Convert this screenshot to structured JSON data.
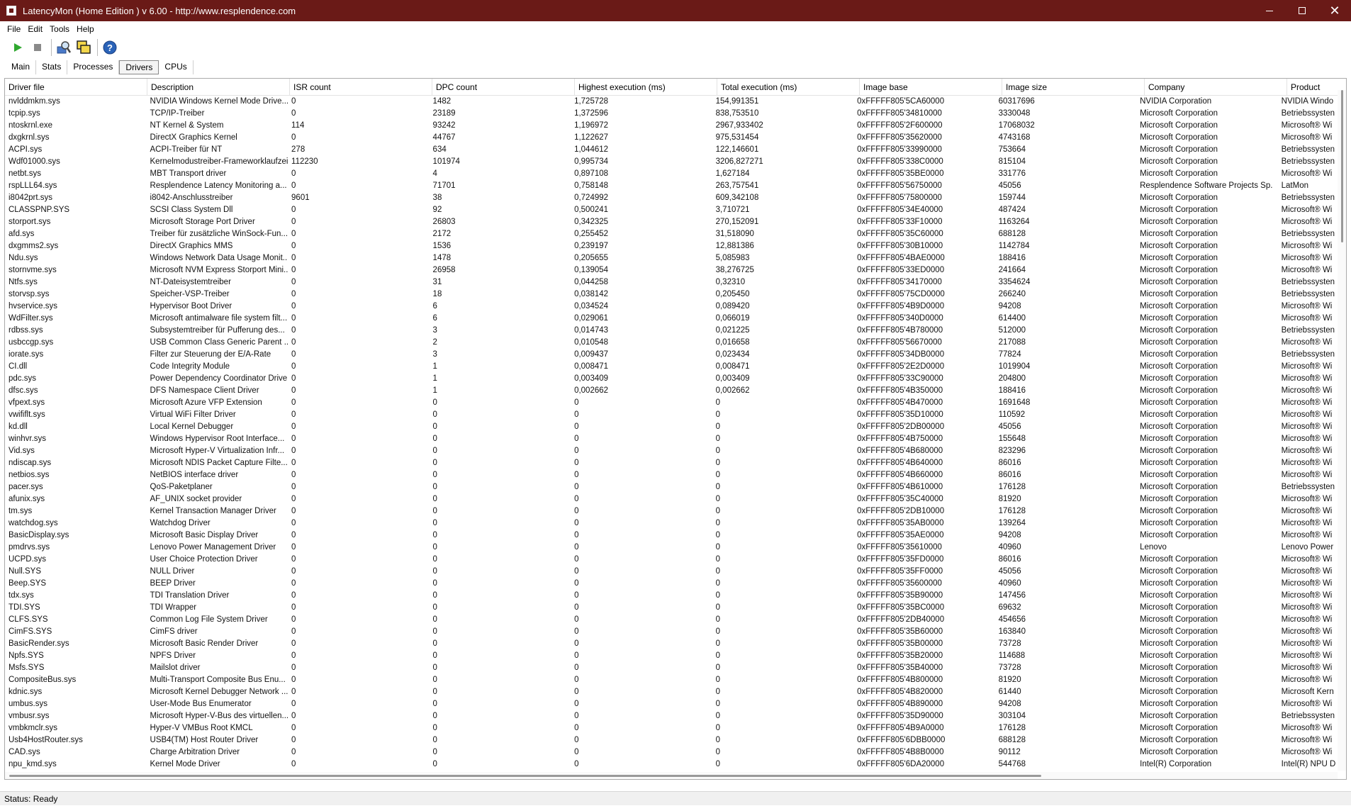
{
  "window": {
    "title": "LatencyMon  (Home Edition )  v 6.00 - http://www.resplendence.com",
    "minimize_label": "—",
    "close_label": "✕"
  },
  "menu": {
    "items": [
      "File",
      "Edit",
      "Tools",
      "Help"
    ]
  },
  "toolbar": {
    "buttons": [
      "play-icon",
      "stop-icon",
      "search-driver-icon",
      "windows-icon",
      "help-icon"
    ]
  },
  "tabs": {
    "items": [
      "Main",
      "Stats",
      "Processes",
      "Drivers",
      "CPUs"
    ],
    "active": "Drivers"
  },
  "table": {
    "columns": [
      "Driver file",
      "Description",
      "ISR count",
      "DPC count",
      "Highest execution (ms)",
      "Total execution (ms)",
      "Image base",
      "Image size",
      "Company",
      "Product"
    ],
    "rows": [
      [
        "nvlddmkm.sys",
        "NVIDIA Windows Kernel Mode Drive...",
        "0",
        "1482",
        "1,725728",
        "154,991351",
        "0xFFFFF805'5CA60000",
        "60317696",
        "NVIDIA Corporation",
        "NVIDIA Windo"
      ],
      [
        "tcpip.sys",
        "TCP/IP-Treiber",
        "0",
        "23189",
        "1,372596",
        "838,753510",
        "0xFFFFF805'34810000",
        "3330048",
        "Microsoft Corporation",
        "Betriebssysten"
      ],
      [
        "ntoskrnl.exe",
        "NT Kernel & System",
        "114",
        "93242",
        "1,196972",
        "2967,933402",
        "0xFFFFF805'2F600000",
        "17068032",
        "Microsoft Corporation",
        "Microsoft® Wi"
      ],
      [
        "dxgkrnl.sys",
        "DirectX Graphics Kernel",
        "0",
        "44767",
        "1,122627",
        "975,531454",
        "0xFFFFF805'35620000",
        "4743168",
        "Microsoft Corporation",
        "Microsoft® Wi"
      ],
      [
        "ACPI.sys",
        "ACPI-Treiber für NT",
        "278",
        "634",
        "1,044612",
        "122,146601",
        "0xFFFFF805'33990000",
        "753664",
        "Microsoft Corporation",
        "Betriebssysten"
      ],
      [
        "Wdf01000.sys",
        "Kernelmodustreiber-Frameworklaufzeit",
        "112230",
        "101974",
        "0,995734",
        "3206,827271",
        "0xFFFFF805'338C0000",
        "815104",
        "Microsoft Corporation",
        "Betriebssysten"
      ],
      [
        "netbt.sys",
        "MBT Transport driver",
        "0",
        "4",
        "0,897108",
        "1,627184",
        "0xFFFFF805'35BE0000",
        "331776",
        "Microsoft Corporation",
        "Microsoft® Wi"
      ],
      [
        "rspLLL64.sys",
        "Resplendence Latency Monitoring a...",
        "0",
        "71701",
        "0,758148",
        "263,757541",
        "0xFFFFF805'56750000",
        "45056",
        "Resplendence Software Projects Sp.",
        "LatMon"
      ],
      [
        "i8042prt.sys",
        "i8042-Anschlusstreiber",
        "9601",
        "38",
        "0,724992",
        "609,342108",
        "0xFFFFF805'75800000",
        "159744",
        "Microsoft Corporation",
        "Betriebssysten"
      ],
      [
        "CLASSPNP.SYS",
        "SCSI Class System Dll",
        "0",
        "92",
        "0,500241",
        "3,710721",
        "0xFFFFF805'34E40000",
        "487424",
        "Microsoft Corporation",
        "Microsoft® Wi"
      ],
      [
        "storport.sys",
        "Microsoft Storage Port Driver",
        "0",
        "26803",
        "0,342325",
        "270,152091",
        "0xFFFFF805'33F10000",
        "1163264",
        "Microsoft Corporation",
        "Microsoft® Wi"
      ],
      [
        "afd.sys",
        "Treiber für zusätzliche WinSock-Fun...",
        "0",
        "2172",
        "0,255452",
        "31,518090",
        "0xFFFFF805'35C60000",
        "688128",
        "Microsoft Corporation",
        "Betriebssysten"
      ],
      [
        "dxgmms2.sys",
        "DirectX Graphics MMS",
        "0",
        "1536",
        "0,239197",
        "12,881386",
        "0xFFFFF805'30B10000",
        "1142784",
        "Microsoft Corporation",
        "Microsoft® Wi"
      ],
      [
        "Ndu.sys",
        "Windows Network Data Usage Monit...",
        "0",
        "1478",
        "0,205655",
        "5,085983",
        "0xFFFFF805'4BAE0000",
        "188416",
        "Microsoft Corporation",
        "Microsoft® Wi"
      ],
      [
        "stornvme.sys",
        "Microsoft NVM Express Storport Mini...",
        "0",
        "26958",
        "0,139054",
        "38,276725",
        "0xFFFFF805'33ED0000",
        "241664",
        "Microsoft Corporation",
        "Microsoft® Wi"
      ],
      [
        "Ntfs.sys",
        "NT-Dateisystemtreiber",
        "0",
        "31",
        "0,044258",
        "0,32310",
        "0xFFFFF805'34170000",
        "3354624",
        "Microsoft Corporation",
        "Betriebssysten"
      ],
      [
        "storvsp.sys",
        "Speicher-VSP-Treiber",
        "0",
        "18",
        "0,038142",
        "0,205450",
        "0xFFFFF805'75CD0000",
        "266240",
        "Microsoft Corporation",
        "Betriebssysten"
      ],
      [
        "hvservice.sys",
        "Hypervisor Boot Driver",
        "0",
        "6",
        "0,034524",
        "0,089420",
        "0xFFFFF805'4B9D0000",
        "94208",
        "Microsoft Corporation",
        "Microsoft® Wi"
      ],
      [
        "WdFilter.sys",
        "Microsoft antimalware file system filt...",
        "0",
        "6",
        "0,029061",
        "0,066019",
        "0xFFFFF805'340D0000",
        "614400",
        "Microsoft Corporation",
        "Microsoft® Wi"
      ],
      [
        "rdbss.sys",
        "Subsystemtreiber für Pufferung des...",
        "0",
        "3",
        "0,014743",
        "0,021225",
        "0xFFFFF805'4B780000",
        "512000",
        "Microsoft Corporation",
        "Betriebssysten"
      ],
      [
        "usbccgp.sys",
        "USB Common Class Generic Parent ...",
        "0",
        "2",
        "0,010548",
        "0,016658",
        "0xFFFFF805'56670000",
        "217088",
        "Microsoft Corporation",
        "Microsoft® Wi"
      ],
      [
        "iorate.sys",
        "Filter zur Steuerung der E/A-Rate",
        "0",
        "3",
        "0,009437",
        "0,023434",
        "0xFFFFF805'34DB0000",
        "77824",
        "Microsoft Corporation",
        "Betriebssysten"
      ],
      [
        "CI.dll",
        "Code Integrity Module",
        "0",
        "1",
        "0,008471",
        "0,008471",
        "0xFFFFF805'2E2D0000",
        "1019904",
        "Microsoft Corporation",
        "Microsoft® Wi"
      ],
      [
        "pdc.sys",
        "Power Dependency Coordinator Driver",
        "0",
        "1",
        "0,003409",
        "0,003409",
        "0xFFFFF805'33C90000",
        "204800",
        "Microsoft Corporation",
        "Microsoft® Wi"
      ],
      [
        "dfsc.sys",
        "DFS Namespace Client Driver",
        "0",
        "1",
        "0,002662",
        "0,002662",
        "0xFFFFF805'4B350000",
        "188416",
        "Microsoft Corporation",
        "Microsoft® Wi"
      ],
      [
        "vfpext.sys",
        "Microsoft Azure VFP Extension",
        "0",
        "0",
        "0",
        "0",
        "0xFFFFF805'4B470000",
        "1691648",
        "Microsoft Corporation",
        "Microsoft® Wi"
      ],
      [
        "vwififlt.sys",
        "Virtual WiFi Filter Driver",
        "0",
        "0",
        "0",
        "0",
        "0xFFFFF805'35D10000",
        "110592",
        "Microsoft Corporation",
        "Microsoft® Wi"
      ],
      [
        "kd.dll",
        "Local Kernel Debugger",
        "0",
        "0",
        "0",
        "0",
        "0xFFFFF805'2DB00000",
        "45056",
        "Microsoft Corporation",
        "Microsoft® Wi"
      ],
      [
        "winhvr.sys",
        "Windows Hypervisor Root Interface...",
        "0",
        "0",
        "0",
        "0",
        "0xFFFFF805'4B750000",
        "155648",
        "Microsoft Corporation",
        "Microsoft® Wi"
      ],
      [
        "Vid.sys",
        "Microsoft Hyper-V Virtualization Infr...",
        "0",
        "0",
        "0",
        "0",
        "0xFFFFF805'4B680000",
        "823296",
        "Microsoft Corporation",
        "Microsoft® Wi"
      ],
      [
        "ndiscap.sys",
        "Microsoft NDIS Packet Capture Filte...",
        "0",
        "0",
        "0",
        "0",
        "0xFFFFF805'4B640000",
        "86016",
        "Microsoft Corporation",
        "Microsoft® Wi"
      ],
      [
        "netbios.sys",
        "NetBIOS interface driver",
        "0",
        "0",
        "0",
        "0",
        "0xFFFFF805'4B660000",
        "86016",
        "Microsoft Corporation",
        "Microsoft® Wi"
      ],
      [
        "pacer.sys",
        "QoS-Paketplaner",
        "0",
        "0",
        "0",
        "0",
        "0xFFFFF805'4B610000",
        "176128",
        "Microsoft Corporation",
        "Betriebssysten"
      ],
      [
        "afunix.sys",
        "AF_UNIX socket provider",
        "0",
        "0",
        "0",
        "0",
        "0xFFFFF805'35C40000",
        "81920",
        "Microsoft Corporation",
        "Microsoft® Wi"
      ],
      [
        "tm.sys",
        "Kernel Transaction Manager Driver",
        "0",
        "0",
        "0",
        "0",
        "0xFFFFF805'2DB10000",
        "176128",
        "Microsoft Corporation",
        "Microsoft® Wi"
      ],
      [
        "watchdog.sys",
        "Watchdog Driver",
        "0",
        "0",
        "0",
        "0",
        "0xFFFFF805'35AB0000",
        "139264",
        "Microsoft Corporation",
        "Microsoft® Wi"
      ],
      [
        "BasicDisplay.sys",
        "Microsoft Basic Display Driver",
        "0",
        "0",
        "0",
        "0",
        "0xFFFFF805'35AE0000",
        "94208",
        "Microsoft Corporation",
        "Microsoft® Wi"
      ],
      [
        "pmdrvs.sys",
        "Lenovo Power Management Driver",
        "0",
        "0",
        "0",
        "0",
        "0xFFFFF805'35610000",
        "40960",
        "Lenovo",
        "Lenovo Power"
      ],
      [
        "UCPD.sys",
        "User Choice Protection Driver",
        "0",
        "0",
        "0",
        "0",
        "0xFFFFF805'35FD0000",
        "86016",
        "Microsoft Corporation",
        "Microsoft® Wi"
      ],
      [
        "Null.SYS",
        "NULL Driver",
        "0",
        "0",
        "0",
        "0",
        "0xFFFFF805'35FF0000",
        "45056",
        "Microsoft Corporation",
        "Microsoft® Wi"
      ],
      [
        "Beep.SYS",
        "BEEP Driver",
        "0",
        "0",
        "0",
        "0",
        "0xFFFFF805'35600000",
        "40960",
        "Microsoft Corporation",
        "Microsoft® Wi"
      ],
      [
        "tdx.sys",
        "TDI Translation Driver",
        "0",
        "0",
        "0",
        "0",
        "0xFFFFF805'35B90000",
        "147456",
        "Microsoft Corporation",
        "Microsoft® Wi"
      ],
      [
        "TDI.SYS",
        "TDI Wrapper",
        "0",
        "0",
        "0",
        "0",
        "0xFFFFF805'35BC0000",
        "69632",
        "Microsoft Corporation",
        "Microsoft® Wi"
      ],
      [
        "CLFS.SYS",
        "Common Log File System Driver",
        "0",
        "0",
        "0",
        "0",
        "0xFFFFF805'2DB40000",
        "454656",
        "Microsoft Corporation",
        "Microsoft® Wi"
      ],
      [
        "CimFS.SYS",
        "CimFS driver",
        "0",
        "0",
        "0",
        "0",
        "0xFFFFF805'35B60000",
        "163840",
        "Microsoft Corporation",
        "Microsoft® Wi"
      ],
      [
        "BasicRender.sys",
        "Microsoft Basic Render Driver",
        "0",
        "0",
        "0",
        "0",
        "0xFFFFF805'35B00000",
        "73728",
        "Microsoft Corporation",
        "Microsoft® Wi"
      ],
      [
        "Npfs.SYS",
        "NPFS Driver",
        "0",
        "0",
        "0",
        "0",
        "0xFFFFF805'35B20000",
        "114688",
        "Microsoft Corporation",
        "Microsoft® Wi"
      ],
      [
        "Msfs.SYS",
        "Mailslot driver",
        "0",
        "0",
        "0",
        "0",
        "0xFFFFF805'35B40000",
        "73728",
        "Microsoft Corporation",
        "Microsoft® Wi"
      ],
      [
        "CompositeBus.sys",
        "Multi-Transport Composite Bus Enu...",
        "0",
        "0",
        "0",
        "0",
        "0xFFFFF805'4B800000",
        "81920",
        "Microsoft Corporation",
        "Microsoft® Wi"
      ],
      [
        "kdnic.sys",
        "Microsoft Kernel Debugger Network ...",
        "0",
        "0",
        "0",
        "0",
        "0xFFFFF805'4B820000",
        "61440",
        "Microsoft Corporation",
        "Microsoft Kern"
      ],
      [
        "umbus.sys",
        "User-Mode Bus Enumerator",
        "0",
        "0",
        "0",
        "0",
        "0xFFFFF805'4B890000",
        "94208",
        "Microsoft Corporation",
        "Microsoft® Wi"
      ],
      [
        "vmbusr.sys",
        "Microsoft Hyper-V-Bus des virtuellen...",
        "0",
        "0",
        "0",
        "0",
        "0xFFFFF805'35D90000",
        "303104",
        "Microsoft Corporation",
        "Betriebssysten"
      ],
      [
        "vmbkmclr.sys",
        "Hyper-V VMBus Root KMCL",
        "0",
        "0",
        "0",
        "0",
        "0xFFFFF805'4B9A0000",
        "176128",
        "Microsoft Corporation",
        "Microsoft® Wi"
      ],
      [
        "Usb4HostRouter.sys",
        "USB4(TM) Host Router Driver",
        "0",
        "0",
        "0",
        "0",
        "0xFFFFF805'6DBB0000",
        "688128",
        "Microsoft Corporation",
        "Microsoft® Wi"
      ],
      [
        "CAD.sys",
        "Charge Arbitration Driver",
        "0",
        "0",
        "0",
        "0",
        "0xFFFFF805'4B8B0000",
        "90112",
        "Microsoft Corporation",
        "Microsoft® Wi"
      ],
      [
        "npu_kmd.sys",
        "Kernel Mode Driver",
        "0",
        "0",
        "0",
        "0",
        "0xFFFFF805'6DA20000",
        "544768",
        "Intel(R) Corporation",
        "Intel(R) NPU D"
      ]
    ]
  },
  "status": {
    "text": "Status: Ready"
  },
  "colors": {
    "titlebar": "#6a1a17",
    "play": "#2fa82f",
    "help": "#2a63b8"
  }
}
